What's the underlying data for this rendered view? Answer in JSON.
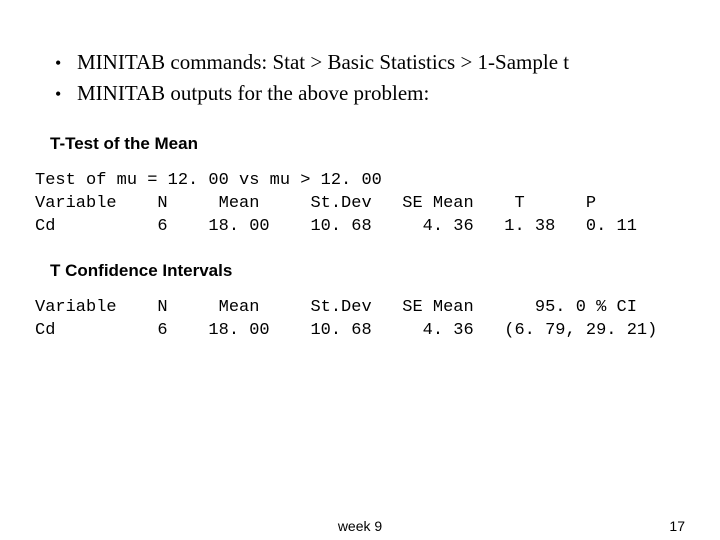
{
  "bullets": {
    "b1": "MINITAB commands: Stat > Basic Statistics > 1-Sample t",
    "b2": "MINITAB outputs for the above problem:"
  },
  "headings": {
    "ttest": "T-Test of the Mean",
    "tci": "T Confidence Intervals"
  },
  "ttest_block": "Test of mu = 12. 00 vs mu > 12. 00\nVariable    N     Mean     St.Dev   SE Mean    T      P\nCd          6    18. 00    10. 68     4. 36   1. 38   0. 11",
  "tci_block": "Variable    N     Mean     St.Dev   SE Mean      95. 0 % CI\nCd          6    18. 00    10. 68     4. 36   (6. 79, 29. 21)",
  "footer": {
    "center": "week 9",
    "page": "17"
  },
  "chart_data": {
    "type": "table",
    "tables": [
      {
        "title": "T-Test of the Mean",
        "note": "Test of mu = 12.00 vs mu > 12.00",
        "columns": [
          "Variable",
          "N",
          "Mean",
          "St.Dev",
          "SE Mean",
          "T",
          "P"
        ],
        "rows": [
          [
            "Cd",
            6,
            18.0,
            10.68,
            4.36,
            1.38,
            0.11
          ]
        ]
      },
      {
        "title": "T Confidence Intervals",
        "columns": [
          "Variable",
          "N",
          "Mean",
          "St.Dev",
          "SE Mean",
          "95.0 % CI"
        ],
        "rows": [
          [
            "Cd",
            6,
            18.0,
            10.68,
            4.36,
            "(6.79, 29.21)"
          ]
        ]
      }
    ]
  }
}
